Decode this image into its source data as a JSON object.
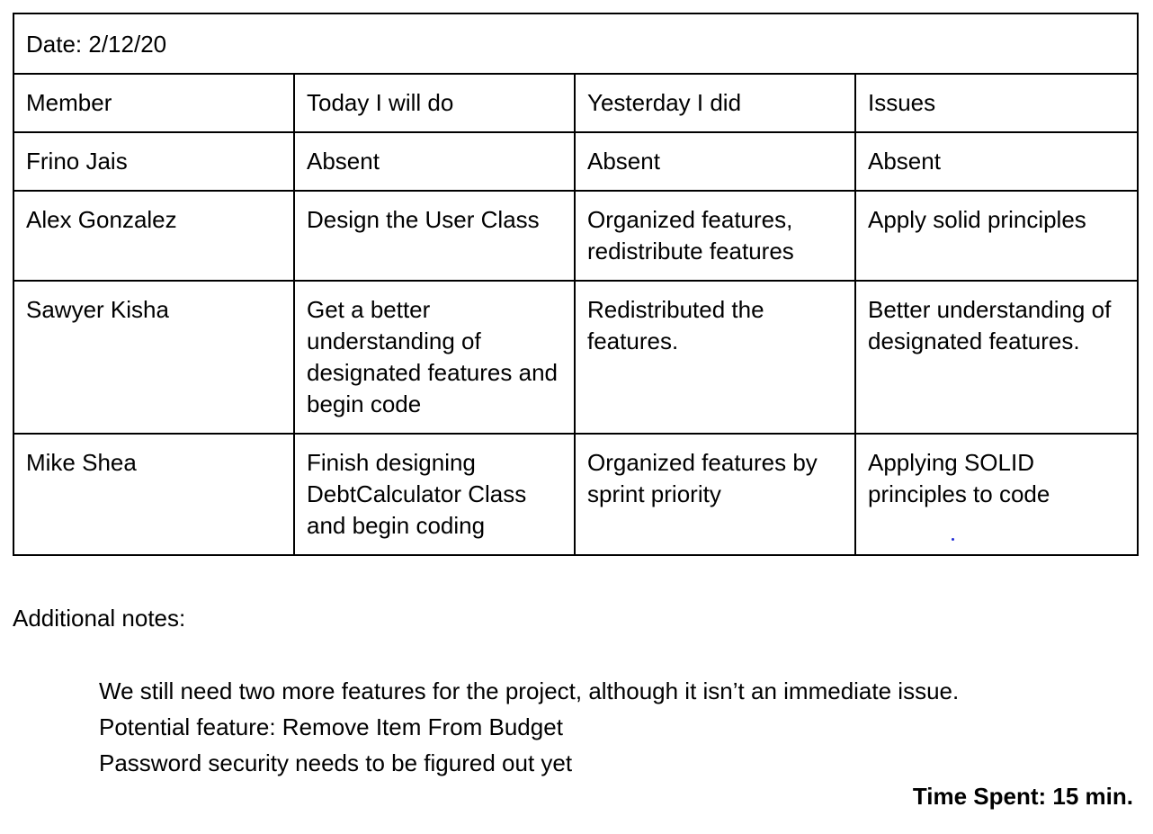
{
  "table": {
    "date": "Date: 2/12/20",
    "headers": [
      "Member",
      "Today I will do",
      "Yesterday I did",
      "Issues"
    ],
    "rows": [
      [
        "Frino Jais",
        "Absent",
        "Absent",
        "Absent"
      ],
      [
        "Alex Gonzalez",
        "Design the User Class",
        "Organized features, redistribute features",
        "Apply solid principles"
      ],
      [
        "Sawyer Kisha",
        "Get a better understanding of designated features and begin code",
        "Redistributed the features.",
        "Better understanding of designated features."
      ],
      [
        "Mike Shea",
        "Finish designing DebtCalculator Class and begin coding",
        "Organized features by sprint priority",
        "Applying SOLID principles to code"
      ]
    ]
  },
  "notes": {
    "heading": "Additional notes:",
    "items": [
      "We still need two more features for the project, although it isn’t an immediate issue.",
      "Potential feature: Remove Item From Budget",
      "Password security needs to be figured out yet"
    ]
  },
  "time_spent": "Time Spent: 15 min.",
  "colors": {
    "text": "#000000",
    "border": "#000000",
    "cursor": "#1f2bd6"
  }
}
